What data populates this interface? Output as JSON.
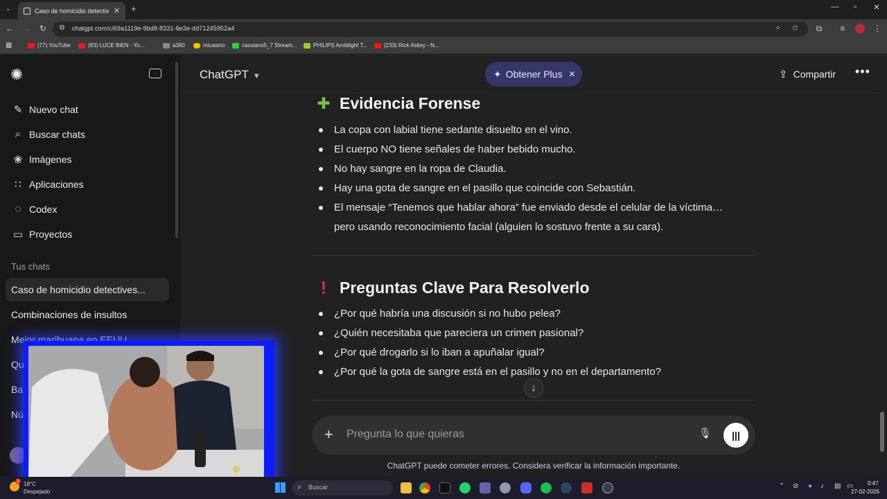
{
  "browser": {
    "tab_title": "Caso de homicidio detectivesco",
    "url": "chatgpt.com/c/69a1119e-9bd8-8331-8e3e-dd71245952a4",
    "bookmarks": [
      {
        "label": "(77) YouTube",
        "color": "#e21b1b"
      },
      {
        "label": "(83) LUCE BIEN - Yo...",
        "color": "#e21b1b"
      },
      {
        "label": "a360",
        "color": "#888888"
      },
      {
        "label": "micasino",
        "color": "#f2c200"
      },
      {
        "label": "cassiano5_7 Stream...",
        "color": "#2ecc40"
      },
      {
        "label": "PHILIPS Ambilight T...",
        "color": "#9acd32"
      },
      {
        "label": "(233) Rick Astley - N...",
        "color": "#e21b1b"
      }
    ]
  },
  "sidebar": {
    "nav": [
      {
        "label": "Nuevo chat",
        "icon": "edit-icon"
      },
      {
        "label": "Buscar chats",
        "icon": "search-icon"
      },
      {
        "label": "Imágenes",
        "icon": "images-icon"
      },
      {
        "label": "Aplicaciones",
        "icon": "apps-icon"
      },
      {
        "label": "Codex",
        "icon": "codex-icon"
      },
      {
        "label": "Proyectos",
        "icon": "folder-icon"
      }
    ],
    "section_label": "Tus chats",
    "chats": [
      "Caso de homicidio detectives...",
      "Combinaciones de insultos",
      "Mejor marihuana en EEUU",
      "Qui",
      "Ban",
      "Núm"
    ]
  },
  "header": {
    "title": "ChatGPT",
    "plus_label": "Obtener Plus",
    "share_label": "Compartir"
  },
  "content": {
    "section1_title": "Evidencia Forense",
    "section1_items": [
      "La copa con labial tiene sedante disuelto en el vino.",
      "El cuerpo NO tiene señales de haber bebido mucho.",
      "No hay sangre en la ropa de Claudia.",
      "Hay una gota de sangre en el pasillo que coincide con Sebastián.",
      "El mensaje “Tenemos que hablar ahora” fue enviado desde el celular de la víctima…",
      "pero usando reconocimiento facial (alguien lo sostuvo frente a su cara)."
    ],
    "section2_title": "Preguntas Clave Para Resolverlo",
    "section2_items": [
      "¿Por qué habría una discusión si no hubo pelea?",
      "¿Quién necesitaba que pareciera un crimen pasional?",
      "¿Por qué drogarlo si lo iban a apuñalar igual?",
      "¿Por qué la gota de sangre está en el pasillo y no en el departamento?"
    ]
  },
  "composer": {
    "placeholder": "Pregunta lo que quieras",
    "disclaimer": "ChatGPT puede cometer errores. Considera verificar la información importante."
  },
  "taskbar": {
    "weather_temp": "18°C",
    "weather_desc": "Despejado",
    "search_label": "Buscar",
    "time": "0:47",
    "date": "27-02-2026",
    "notification_count": "1"
  },
  "colors": {
    "plus_pill": "#373669",
    "webcam_border": "#0b1cff",
    "section2_icon": "#e0245e"
  }
}
